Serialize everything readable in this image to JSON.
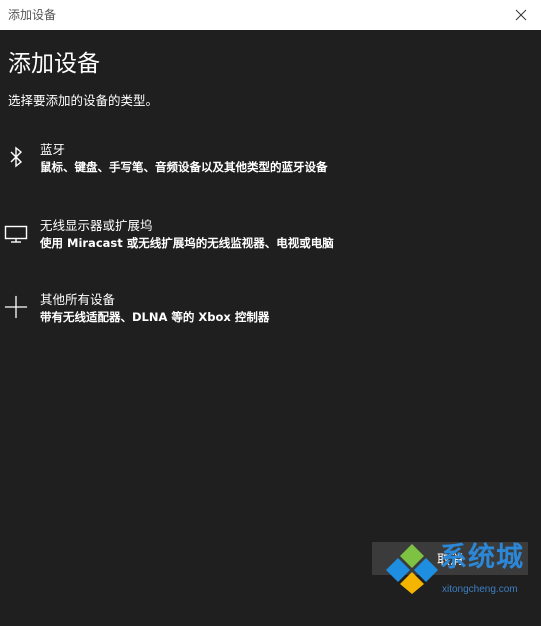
{
  "window": {
    "title": "添加设备",
    "close_icon": "close-icon"
  },
  "main": {
    "heading": "添加设备",
    "subheading": "选择要添加的设备的类型。",
    "options": [
      {
        "icon": "bluetooth-icon",
        "label": "蓝牙",
        "description": "鼠标、键盘、手写笔、音频设备以及其他类型的蓝牙设备"
      },
      {
        "icon": "monitor-icon",
        "label": "无线显示器或扩展坞",
        "description": "使用 Miracast 或无线扩展坞的无线监视器、电视或电脑"
      },
      {
        "icon": "plus-icon",
        "label": "其他所有设备",
        "description": "带有无线适配器、DLNA 等的 Xbox 控制器"
      }
    ]
  },
  "footer": {
    "cancel_label": "取消"
  },
  "watermark": {
    "logo_icon": "windows-logo-icon",
    "text": "系统城",
    "url": "xitongcheng.com"
  },
  "colors": {
    "background": "#1f1f1f",
    "titlebar": "#ffffff",
    "button": "#3b3b3b",
    "watermark_blue": "#2b88d9"
  }
}
